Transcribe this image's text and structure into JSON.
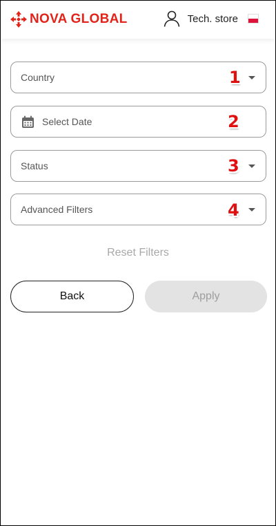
{
  "header": {
    "brand": "NOVA GLOBAL",
    "store_name": "Tech. store",
    "flag_icon": "poland-flag-icon",
    "brand_color": "#e2231a"
  },
  "filters": {
    "country": {
      "label": "Country",
      "badge": "1"
    },
    "date": {
      "label": "Select Date",
      "badge": "2"
    },
    "status": {
      "label": "Status",
      "badge": "3"
    },
    "advanced": {
      "label": "Advanced Filters",
      "badge": "4"
    }
  },
  "actions": {
    "reset_label": "Reset Filters",
    "back_label": "Back",
    "apply_label": "Apply"
  }
}
